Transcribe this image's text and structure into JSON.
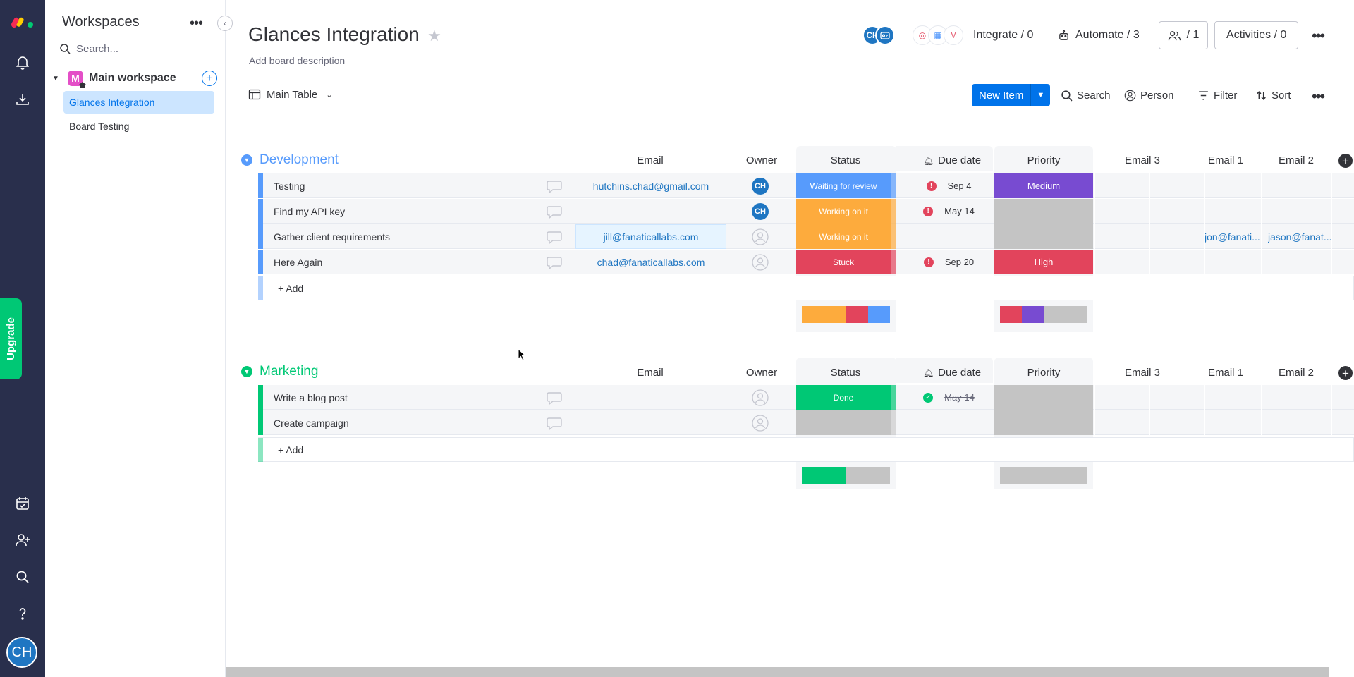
{
  "rail": {
    "upgrade_label": "Upgrade",
    "user_initials": "CH"
  },
  "sidebar": {
    "title": "Workspaces",
    "search_placeholder": "Search...",
    "workspace": {
      "badge": "M",
      "name": "Main workspace"
    },
    "boards": [
      {
        "label": "Glances Integration",
        "active": true
      },
      {
        "label": "Board Testing",
        "active": false
      }
    ]
  },
  "header": {
    "title": "Glances Integration",
    "description": "Add board description",
    "avatar_initials": "CH",
    "integrate_label": "Integrate / 0",
    "automate_label": "Automate / 3",
    "members_label": "/ 1",
    "activities_label": "Activities / 0"
  },
  "toolbar": {
    "view_label": "Main Table",
    "new_item_label": "New Item",
    "search_label": "Search",
    "person_label": "Person",
    "filter_label": "Filter",
    "sort_label": "Sort"
  },
  "columns": {
    "email": "Email",
    "owner": "Owner",
    "status": "Status",
    "due_date": "Due date",
    "priority": "Priority",
    "email3": "Email 3",
    "email1": "Email 1",
    "email2": "Email 2"
  },
  "groups": [
    {
      "title": "Development",
      "color": "#579bfc",
      "add_label": "+ Add",
      "rows": [
        {
          "name": "Testing",
          "email": "hutchins.chad@gmail.com",
          "owner": "CH",
          "status": "Waiting for review",
          "status_color": "#579bfc",
          "due": "Sep 4",
          "due_alert": true,
          "priority": "Medium",
          "priority_color": "#784bd1",
          "email1": "",
          "email2": ""
        },
        {
          "name": "Find my API key",
          "email": "",
          "owner": "CH",
          "status": "Working on it",
          "status_color": "#fdab3d",
          "due": "May 14",
          "due_alert": true,
          "priority": "",
          "priority_color": "#c4c4c4",
          "email1": "",
          "email2": ""
        },
        {
          "name": "Gather client requirements",
          "email": "jill@fanaticallabs.com",
          "owner": "",
          "status": "Working on it",
          "status_color": "#fdab3d",
          "due": "",
          "due_alert": false,
          "priority": "",
          "priority_color": "#c4c4c4",
          "email1": "jon@fanati...",
          "email2": "jason@fanat..."
        },
        {
          "name": "Here Again",
          "email": "chad@fanaticallabs.com",
          "owner": "",
          "status": "Stuck",
          "status_color": "#e2445c",
          "due": "Sep 20",
          "due_alert": true,
          "priority": "High",
          "priority_color": "#e2445c",
          "email1": "",
          "email2": ""
        }
      ],
      "status_summary": [
        {
          "color": "#fdab3d",
          "share": 0.5
        },
        {
          "color": "#e2445c",
          "share": 0.25
        },
        {
          "color": "#579bfc",
          "share": 0.25
        }
      ],
      "priority_summary": [
        {
          "color": "#e2445c",
          "share": 0.25
        },
        {
          "color": "#784bd1",
          "share": 0.25
        },
        {
          "color": "#c4c4c4",
          "share": 0.5
        }
      ]
    },
    {
      "title": "Marketing",
      "color": "#00c875",
      "add_label": "+ Add",
      "rows": [
        {
          "name": "Write a blog post",
          "email": "",
          "owner": "",
          "status": "Done",
          "status_color": "#00c875",
          "due": "May 14",
          "due_done": true,
          "priority": "",
          "priority_color": "#c4c4c4"
        },
        {
          "name": "Create campaign",
          "email": "",
          "owner": "",
          "status": "",
          "status_color": "#c4c4c4",
          "due": "",
          "priority": "",
          "priority_color": "#c4c4c4"
        }
      ],
      "status_summary": [
        {
          "color": "#00c875",
          "share": 0.5
        },
        {
          "color": "#c4c4c4",
          "share": 0.5
        }
      ],
      "priority_summary": [
        {
          "color": "#c4c4c4",
          "share": 1.0
        }
      ]
    }
  ]
}
